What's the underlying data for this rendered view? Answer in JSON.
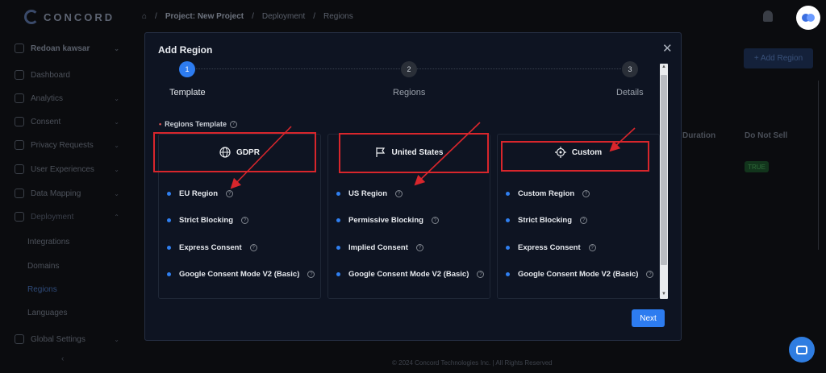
{
  "app": {
    "logo_text": "CONCORD",
    "breadcrumb": [
      "Project: New Project",
      "Deployment",
      "Regions"
    ],
    "user_name": "Redoan kawsar",
    "footer": "© 2024 Concord Technologies Inc. | All Rights Reserved",
    "add_region_label": "+ Add Region",
    "bg_columns": [
      "Duration",
      "Do Not Sell"
    ],
    "bg_badge": "TRUE"
  },
  "sidebar": {
    "items": [
      {
        "label": "Dashboard"
      },
      {
        "label": "Analytics"
      },
      {
        "label": "Consent"
      },
      {
        "label": "Privacy Requests"
      },
      {
        "label": "User Experiences"
      },
      {
        "label": "Data Mapping"
      },
      {
        "label": "Deployment"
      },
      {
        "label": "Global Settings"
      }
    ],
    "sub_items": [
      "Integrations",
      "Domains",
      "Regions",
      "Languages"
    ]
  },
  "modal": {
    "title": "Add Region",
    "steps": [
      {
        "num": "1",
        "label": "Template"
      },
      {
        "num": "2",
        "label": "Regions"
      },
      {
        "num": "3",
        "label": "Details"
      }
    ],
    "regions_template_label": "Regions Template",
    "next_label": "Next",
    "cards": [
      {
        "title": "GDPR",
        "icon": "globe-icon",
        "options": [
          "EU Region",
          "Strict Blocking",
          "Express Consent",
          "Google Consent Mode V2 (Basic)"
        ]
      },
      {
        "title": "United States",
        "icon": "flag-icon",
        "options": [
          "US Region",
          "Permissive Blocking",
          "Implied Consent",
          "Google Consent Mode V2 (Basic)"
        ]
      },
      {
        "title": "Custom",
        "icon": "crosshair-icon",
        "options": [
          "Custom Region",
          "Strict Blocking",
          "Express Consent",
          "Google Consent Mode V2 (Basic)"
        ]
      }
    ]
  },
  "colors": {
    "accent": "#2d7cf0",
    "highlight_red": "#d8262c",
    "modal_bg": "#0e1422"
  }
}
